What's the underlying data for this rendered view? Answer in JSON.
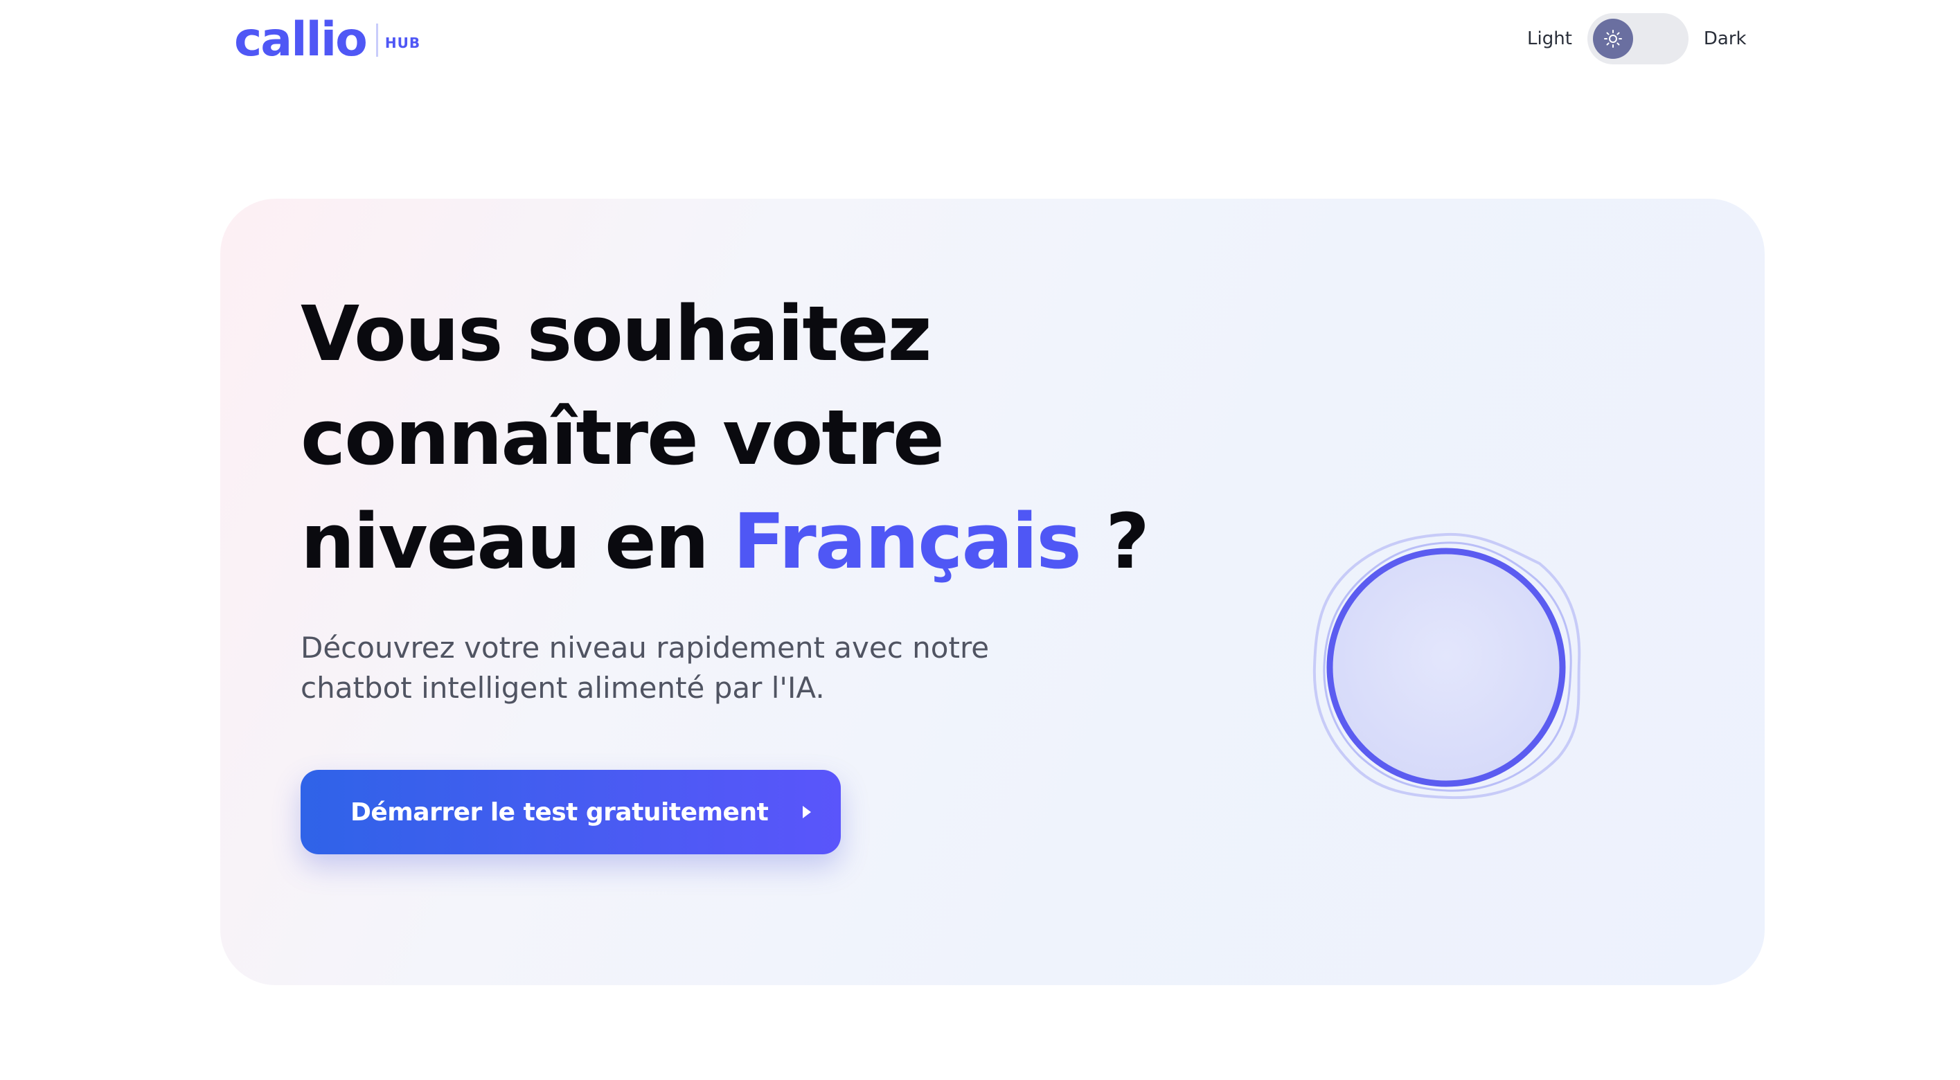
{
  "header": {
    "logo_text": "callio",
    "logo_badge": "HUB",
    "theme_toggle": {
      "light_label": "Light",
      "dark_label": "Dark",
      "selected": "Light",
      "knob_icon": "sun-icon"
    }
  },
  "hero": {
    "headline_part1": "Vous souhaitez connaître votre niveau en ",
    "headline_accent": "Français",
    "headline_part2": " ?",
    "subtitle": "Découvrez votre niveau rapidement avec notre chatbot intelligent alimenté par l'IA.",
    "cta_label": "Démarrer le test gratuitement",
    "cta_icon": "play-icon",
    "orb_icon": "voice-orb-icon"
  },
  "colors": {
    "brand": "#4f57f5",
    "cta_start": "#2f63e8",
    "cta_end": "#5a55fb",
    "headline": "#0a0a0f",
    "subtitle": "#505462"
  }
}
